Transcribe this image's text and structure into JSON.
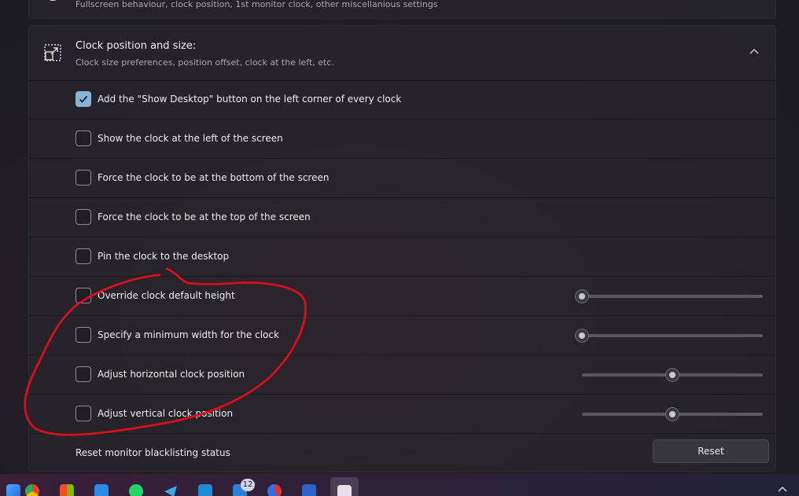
{
  "top_section": {
    "subtitle": "Fullscreen behaviour, clock position, 1st monitor clock, other miscellanious settings"
  },
  "section": {
    "title": "Clock position and size:",
    "subtitle": "Clock size preferences, position offset, clock at the left, etc.",
    "expanded": true
  },
  "options": [
    {
      "label": "Add the \"Show Desktop\" button on the left corner of every clock",
      "checked": true
    },
    {
      "label": "Show the clock at the left of the screen",
      "checked": false
    },
    {
      "label": "Force the clock to be at the bottom of the screen",
      "checked": false
    },
    {
      "label": "Force the clock to be at the top of the screen",
      "checked": false
    },
    {
      "label": "Pin the clock to the desktop",
      "checked": false
    },
    {
      "label": "Override clock default height",
      "checked": false,
      "slider": 0.0
    },
    {
      "label": "Specify a minimum width for the clock",
      "checked": false,
      "slider": 0.0
    },
    {
      "label": "Adjust horizontal clock position",
      "checked": false,
      "slider": 0.5
    },
    {
      "label": "Adjust vertical clock position",
      "checked": false,
      "slider": 0.5
    }
  ],
  "reset": {
    "label": "Reset monitor blacklisting status",
    "button": "Reset"
  },
  "taskbar": {
    "apps": [
      "chrome-icon",
      "microsoft-store-icon",
      "mail-icon",
      "whatsapp-icon",
      "telegram-icon",
      "vscode-icon",
      "files-icon",
      "ccleaner-icon",
      "word-icon",
      "elevenclock-icon"
    ],
    "badge_count": "12"
  },
  "colors": {
    "accent": "#8ab2d6",
    "annotation": "#d4101c"
  }
}
